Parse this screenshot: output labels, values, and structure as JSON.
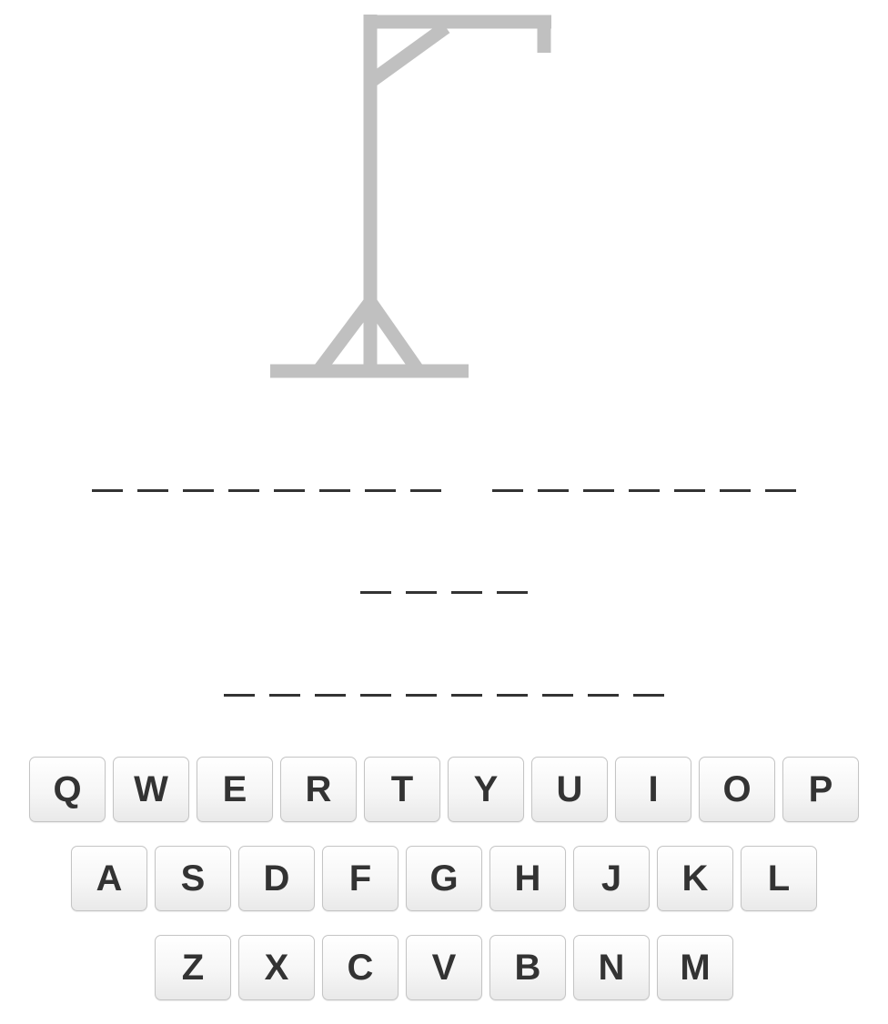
{
  "gallows": {
    "color": "#c0c0c0",
    "wrong_guesses": 0
  },
  "puzzle": {
    "lines": [
      {
        "words": [
          8,
          7
        ]
      },
      {
        "words": [
          4
        ]
      },
      {
        "words": [
          10
        ]
      }
    ]
  },
  "keyboard": {
    "rows": [
      [
        "Q",
        "W",
        "E",
        "R",
        "T",
        "Y",
        "U",
        "I",
        "O",
        "P"
      ],
      [
        "A",
        "S",
        "D",
        "F",
        "G",
        "H",
        "J",
        "K",
        "L"
      ],
      [
        "Z",
        "X",
        "C",
        "V",
        "B",
        "N",
        "M"
      ]
    ]
  }
}
